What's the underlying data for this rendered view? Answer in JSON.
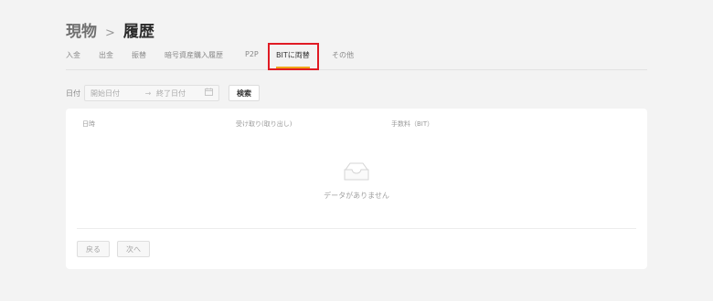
{
  "breadcrumb": {
    "parent": "現物",
    "separator": ">",
    "current": "履歴"
  },
  "tabs": [
    {
      "label": "入金"
    },
    {
      "label": "出金"
    },
    {
      "label": "振替"
    },
    {
      "label": "暗号資産購入履歴"
    },
    {
      "label": "P2P"
    },
    {
      "label": "BITに両替",
      "active": true
    },
    {
      "label": "その他"
    }
  ],
  "filter": {
    "label": "日付",
    "start_placeholder": "開始日付",
    "arrow": "→",
    "end_placeholder": "終了日付",
    "search_label": "検索"
  },
  "table": {
    "columns": [
      "日時",
      "受け取り(取り出し)",
      "手数料（BIT）"
    ],
    "empty_text": "データがありません"
  },
  "pagination": {
    "prev_label": "戻る",
    "next_label": "次へ"
  },
  "colors": {
    "active_underline": "#f0a418",
    "highlight_box": "#e01b24",
    "background": "#f3f3f3"
  }
}
